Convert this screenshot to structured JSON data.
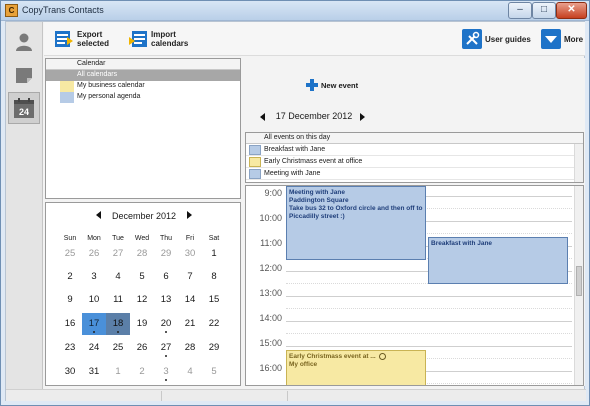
{
  "window": {
    "title": "CopyTrans Contacts",
    "app_icon_glyph": "C",
    "minimize": "–",
    "maximize": "□",
    "close": "✕"
  },
  "toolbar": {
    "export_label": "Export\nselected",
    "import_label": "Import\ncalendars",
    "guides_label": "User guides",
    "more_label": "More"
  },
  "sidebar": {
    "icons": [
      "contacts-icon",
      "notes-icon",
      "calendar-icon"
    ],
    "calendar_badge": "24"
  },
  "calendars": {
    "header": "Calendar",
    "items": [
      {
        "label": "All calendars",
        "color": "#a7a7a7",
        "selected": true
      },
      {
        "label": "My business calendar",
        "color": "#f7e9a3",
        "selected": false
      },
      {
        "label": "My personal agenda",
        "color": "#b6cbe6",
        "selected": false
      }
    ]
  },
  "mini_calendar": {
    "title": "December 2012",
    "weekdays": [
      "Sun",
      "Mon",
      "Tue",
      "Wed",
      "Thu",
      "Fri",
      "Sat"
    ],
    "weeks": [
      [
        "25",
        "26",
        "27",
        "28",
        "29",
        "30",
        "1"
      ],
      [
        "2",
        "3",
        "4",
        "5",
        "6",
        "7",
        "8"
      ],
      [
        "9",
        "10",
        "11",
        "12",
        "13",
        "14",
        "15"
      ],
      [
        "16",
        "17",
        "18",
        "19",
        "20",
        "21",
        "22"
      ],
      [
        "23",
        "24",
        "25",
        "26",
        "27",
        "28",
        "29"
      ],
      [
        "30",
        "31",
        "1",
        "2",
        "3",
        "4",
        "5"
      ]
    ]
  },
  "day_view": {
    "new_event_label": "New event",
    "date": "17 December 2012",
    "all_day_header": "All events on this day",
    "all_day_items": [
      {
        "label": "Breakfast with Jane",
        "color": "#b6cbe6"
      },
      {
        "label": "Early Christmass event at office",
        "color": "#f7e9a3"
      },
      {
        "label": "Meeting with Jane",
        "color": "#b6cbe6"
      }
    ],
    "hours": [
      "9:00",
      "10:00",
      "11:00",
      "12:00",
      "13:00",
      "14:00",
      "15:00",
      "16:00"
    ],
    "events": [
      {
        "lines": [
          "Meeting with Jane",
          "Paddington Square",
          "Take bus 32 to Oxford circle and then off to",
          "Piccadilly street :)"
        ],
        "color": "blue"
      },
      {
        "lines": [
          "Breakfast with Jane"
        ],
        "color": "blue"
      },
      {
        "lines": [
          "Early Christmass event at ...",
          "My office"
        ],
        "color": "yellow"
      }
    ]
  }
}
